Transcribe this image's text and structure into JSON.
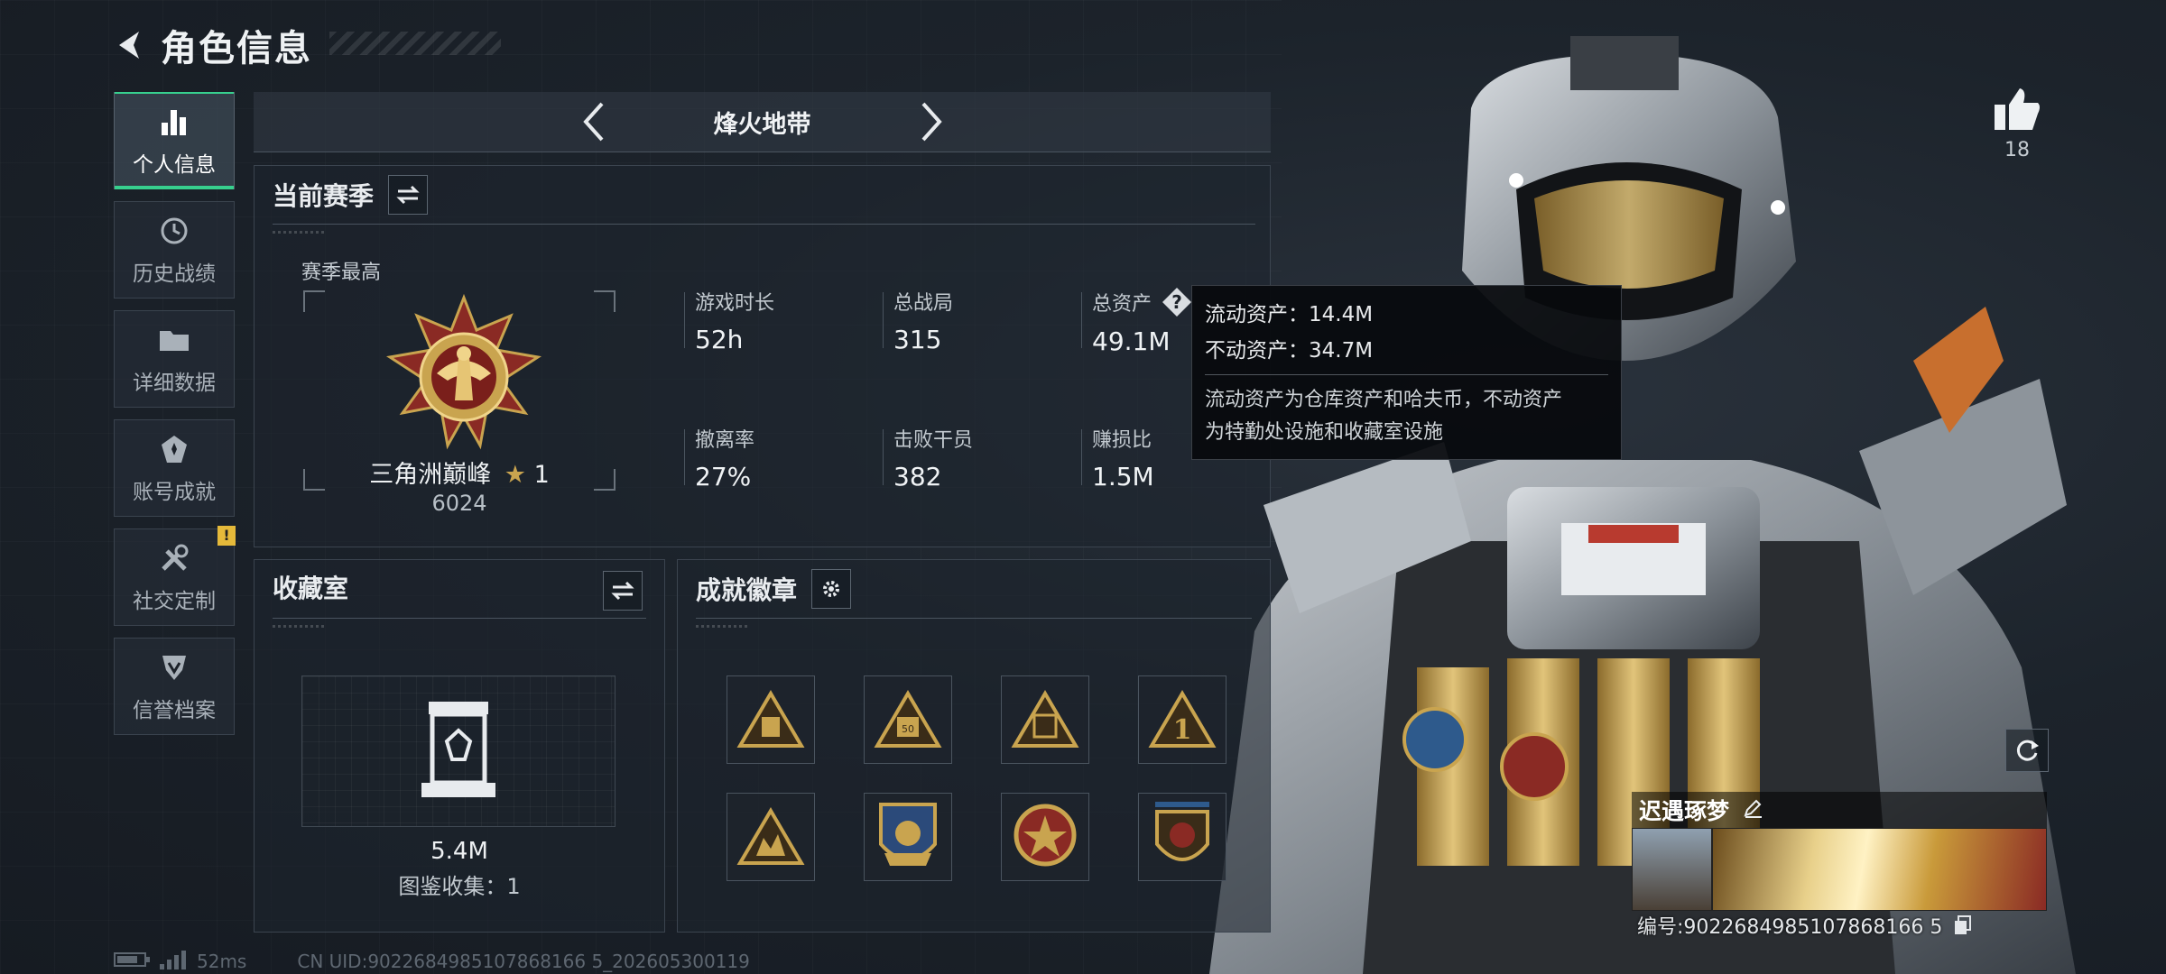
{
  "header": {
    "title": "角色信息"
  },
  "sidebar": {
    "items": [
      {
        "label": "个人信息",
        "icon": "bar-chart-icon"
      },
      {
        "label": "历史战绩",
        "icon": "history-clock-icon"
      },
      {
        "label": "详细数据",
        "icon": "folder-icon"
      },
      {
        "label": "账号成就",
        "icon": "achievement-icon"
      },
      {
        "label": "社交定制",
        "icon": "tools-icon",
        "badge": "!"
      },
      {
        "label": "信誉档案",
        "icon": "shield-check-icon"
      }
    ]
  },
  "mode": {
    "title": "烽火地带"
  },
  "season": {
    "title": "当前赛季",
    "best_label": "赛季最高",
    "rank_name": "三角洲巅峰",
    "rank_stars": "1",
    "rank_score": "6024",
    "stats": [
      {
        "label": "游戏时长",
        "value": "52h"
      },
      {
        "label": "总战局",
        "value": "315"
      },
      {
        "label": "总资产",
        "value": "49.1M"
      },
      {
        "label": "撤离率",
        "value": "27%"
      },
      {
        "label": "击败干员",
        "value": "382"
      },
      {
        "label": "赚损比",
        "value": "1.5M"
      }
    ]
  },
  "tooltip": {
    "liquid": "流动资产：14.4M",
    "fixed": "不动资产：34.7M",
    "desc_line1": "流动资产为仓库资产和哈夫币，不动资产",
    "desc_line2": "为特勤处设施和收藏室设施"
  },
  "collection": {
    "title": "收藏室",
    "value": "5.4M",
    "count": "图鉴收集：1"
  },
  "badges": {
    "title": "成就徽章",
    "items": [
      "badge-1",
      "badge-2",
      "badge-3",
      "badge-4",
      "badge-5",
      "badge-6",
      "badge-7",
      "badge-8"
    ]
  },
  "status": {
    "ping": "52ms",
    "uid": "CN UID:9022684985107868166 5_202605300119"
  },
  "character": {
    "likes": "18",
    "player_name": "迟遇琢梦",
    "player_id": "编号:9022684985107868166 5"
  },
  "colors": {
    "accent": "#37d08e",
    "gold": "#c9a44f",
    "badge_alert": "#e5b93a"
  }
}
